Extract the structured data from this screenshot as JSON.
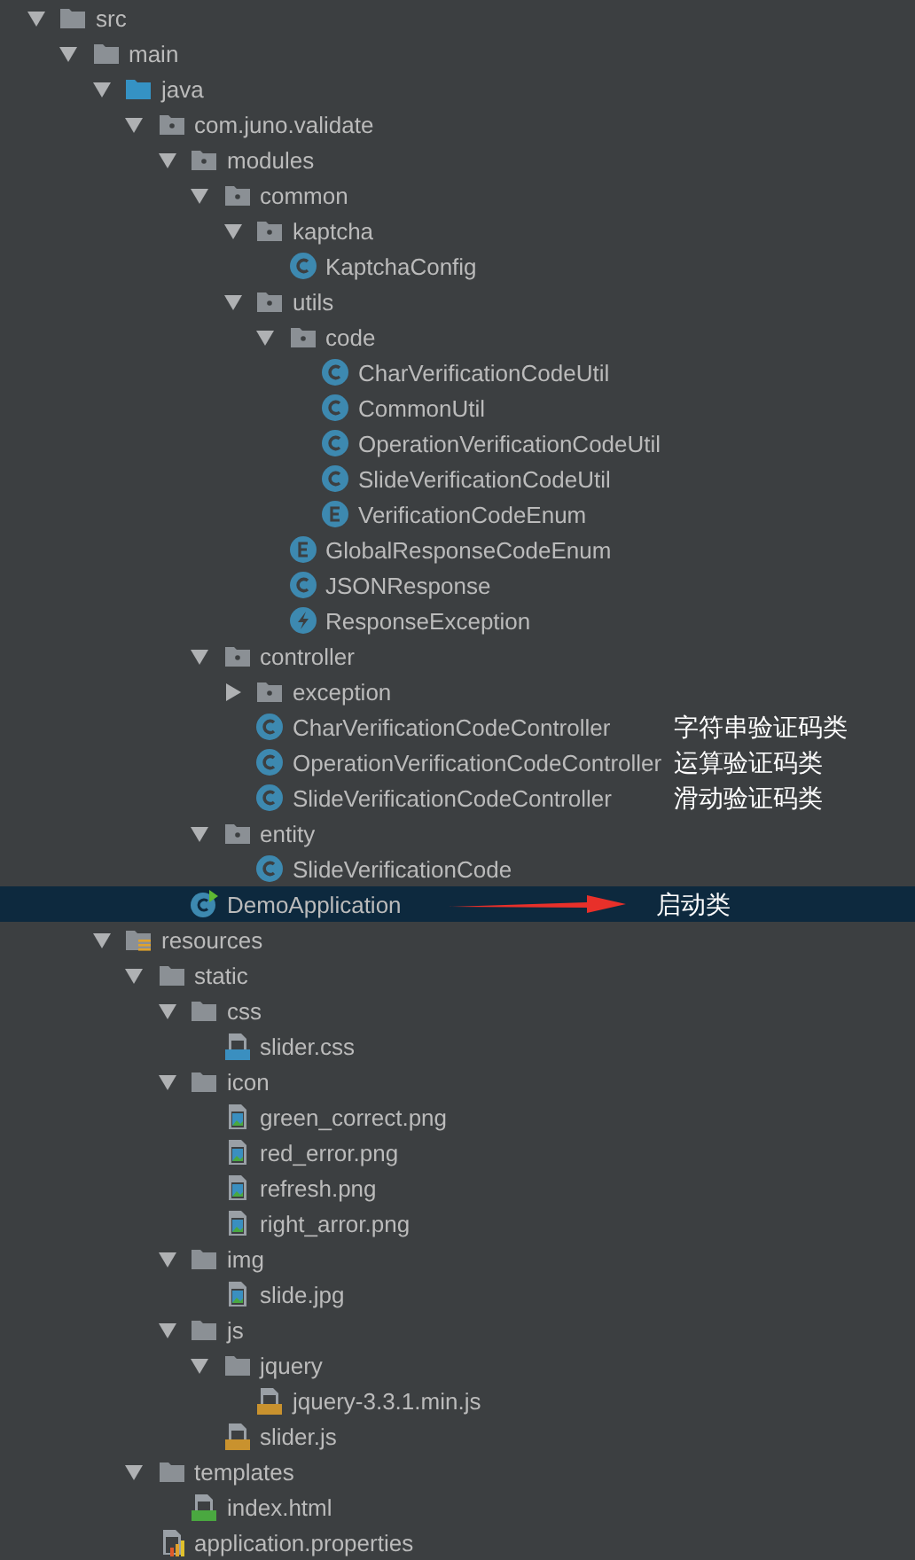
{
  "tree": [
    {
      "label": "src",
      "kind": "folder",
      "expanded": true,
      "selected": false,
      "children": [
        {
          "label": "main",
          "kind": "folder",
          "expanded": true,
          "selected": false,
          "children": [
            {
              "label": "java",
              "kind": "source",
              "expanded": true,
              "selected": false,
              "children": [
                {
                  "label": "com.juno.validate",
                  "kind": "package",
                  "expanded": true,
                  "selected": false,
                  "children": [
                    {
                      "label": "modules",
                      "kind": "package",
                      "expanded": true,
                      "selected": false,
                      "children": [
                        {
                          "label": "common",
                          "kind": "package",
                          "expanded": true,
                          "selected": false,
                          "children": [
                            {
                              "label": "kaptcha",
                              "kind": "package",
                              "expanded": true,
                              "selected": false,
                              "children": [
                                {
                                  "label": "KaptchaConfig",
                                  "kind": "class",
                                  "selected": false
                                }
                              ]
                            },
                            {
                              "label": "utils",
                              "kind": "package",
                              "expanded": true,
                              "selected": false,
                              "children": [
                                {
                                  "label": "code",
                                  "kind": "package",
                                  "expanded": true,
                                  "selected": false,
                                  "children": [
                                    {
                                      "label": "CharVerificationCodeUtil",
                                      "kind": "class",
                                      "selected": false
                                    },
                                    {
                                      "label": "CommonUtil",
                                      "kind": "class",
                                      "selected": false
                                    },
                                    {
                                      "label": "OperationVerificationCodeUtil",
                                      "kind": "class",
                                      "selected": false
                                    },
                                    {
                                      "label": "SlideVerificationCodeUtil",
                                      "kind": "class",
                                      "selected": false
                                    },
                                    {
                                      "label": "VerificationCodeEnum",
                                      "kind": "enum",
                                      "selected": false
                                    }
                                  ]
                                },
                                {
                                  "label": "GlobalResponseCodeEnum",
                                  "kind": "enum",
                                  "selected": false
                                },
                                {
                                  "label": "JSONResponse",
                                  "kind": "class",
                                  "selected": false
                                },
                                {
                                  "label": "ResponseException",
                                  "kind": "exception",
                                  "selected": false
                                }
                              ]
                            }
                          ]
                        },
                        {
                          "label": "controller",
                          "kind": "package",
                          "expanded": true,
                          "selected": false,
                          "children": [
                            {
                              "label": "exception",
                              "kind": "package",
                              "expanded": false,
                              "selected": false
                            },
                            {
                              "label": "CharVerificationCodeController",
                              "kind": "class",
                              "selected": false,
                              "note": "字符串验证码类"
                            },
                            {
                              "label": "OperationVerificationCodeController",
                              "kind": "class",
                              "selected": false,
                              "note": "运算验证码类"
                            },
                            {
                              "label": "SlideVerificationCodeController",
                              "kind": "class",
                              "selected": false,
                              "note": "滑动验证码类"
                            }
                          ]
                        },
                        {
                          "label": "entity",
                          "kind": "package",
                          "expanded": true,
                          "selected": false,
                          "children": [
                            {
                              "label": "SlideVerificationCode",
                              "kind": "class",
                              "selected": false
                            }
                          ]
                        }
                      ]
                    },
                    {
                      "label": "DemoApplication",
                      "kind": "boot",
                      "selected": true,
                      "note": "启动类",
                      "note_arrow": true
                    }
                  ]
                }
              ]
            },
            {
              "label": "resources",
              "kind": "resources",
              "expanded": true,
              "selected": false,
              "children": [
                {
                  "label": "static",
                  "kind": "folder",
                  "expanded": true,
                  "selected": false,
                  "children": [
                    {
                      "label": "css",
                      "kind": "folder",
                      "expanded": true,
                      "selected": false,
                      "children": [
                        {
                          "label": "slider.css",
                          "kind": "css",
                          "selected": false
                        }
                      ]
                    },
                    {
                      "label": "icon",
                      "kind": "folder",
                      "expanded": true,
                      "selected": false,
                      "children": [
                        {
                          "label": "green_correct.png",
                          "kind": "image",
                          "selected": false
                        },
                        {
                          "label": "red_error.png",
                          "kind": "image",
                          "selected": false
                        },
                        {
                          "label": "refresh.png",
                          "kind": "image",
                          "selected": false
                        },
                        {
                          "label": "right_arror.png",
                          "kind": "image",
                          "selected": false
                        }
                      ]
                    },
                    {
                      "label": "img",
                      "kind": "folder",
                      "expanded": true,
                      "selected": false,
                      "children": [
                        {
                          "label": "slide.jpg",
                          "kind": "image",
                          "selected": false
                        }
                      ]
                    },
                    {
                      "label": "js",
                      "kind": "folder",
                      "expanded": true,
                      "selected": false,
                      "children": [
                        {
                          "label": "jquery",
                          "kind": "folder",
                          "expanded": true,
                          "selected": false,
                          "children": [
                            {
                              "label": "jquery-3.3.1.min.js",
                              "kind": "js",
                              "selected": false
                            }
                          ]
                        },
                        {
                          "label": "slider.js",
                          "kind": "js",
                          "selected": false
                        }
                      ]
                    }
                  ]
                },
                {
                  "label": "templates",
                  "kind": "folder",
                  "expanded": true,
                  "selected": false,
                  "children": [
                    {
                      "label": "index.html",
                      "kind": "html",
                      "selected": false
                    }
                  ]
                },
                {
                  "label": "application.properties",
                  "kind": "properties",
                  "selected": false
                }
              ]
            }
          ]
        }
      ]
    }
  ]
}
